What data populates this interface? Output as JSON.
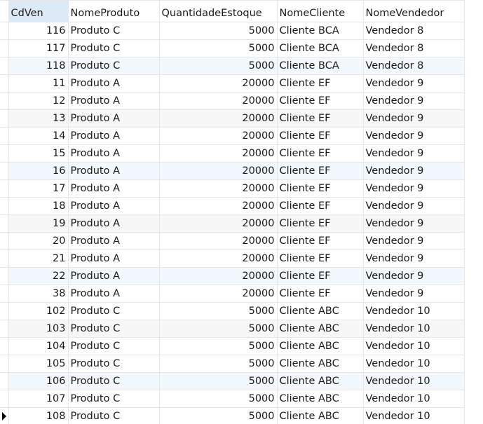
{
  "grid": {
    "columns": [
      "CdVen",
      "NomeProduto",
      "QuantidadeEstoque",
      "NomeCliente",
      "NomeVendedor"
    ],
    "rows": [
      [
        "116",
        "Produto C",
        "5000",
        "Cliente BCA",
        "Vendedor 8"
      ],
      [
        "117",
        "Produto C",
        "5000",
        "Cliente BCA",
        "Vendedor 8"
      ],
      [
        "118",
        "Produto C",
        "5000",
        "Cliente BCA",
        "Vendedor 8"
      ],
      [
        "11",
        "Produto A",
        "20000",
        "Cliente EF",
        "Vendedor 9"
      ],
      [
        "12",
        "Produto A",
        "20000",
        "Cliente EF",
        "Vendedor 9"
      ],
      [
        "13",
        "Produto A",
        "20000",
        "Cliente EF",
        "Vendedor 9"
      ],
      [
        "14",
        "Produto A",
        "20000",
        "Cliente EF",
        "Vendedor 9"
      ],
      [
        "15",
        "Produto A",
        "20000",
        "Cliente EF",
        "Vendedor 9"
      ],
      [
        "16",
        "Produto A",
        "20000",
        "Cliente EF",
        "Vendedor 9"
      ],
      [
        "17",
        "Produto A",
        "20000",
        "Cliente EF",
        "Vendedor 9"
      ],
      [
        "18",
        "Produto A",
        "20000",
        "Cliente EF",
        "Vendedor 9"
      ],
      [
        "19",
        "Produto A",
        "20000",
        "Cliente EF",
        "Vendedor 9"
      ],
      [
        "20",
        "Produto A",
        "20000",
        "Cliente EF",
        "Vendedor 9"
      ],
      [
        "21",
        "Produto A",
        "20000",
        "Cliente EF",
        "Vendedor 9"
      ],
      [
        "22",
        "Produto A",
        "20000",
        "Cliente EF",
        "Vendedor 9"
      ],
      [
        "38",
        "Produto A",
        "20000",
        "Cliente EF",
        "Vendedor 9"
      ],
      [
        "102",
        "Produto C",
        "5000",
        "Cliente ABC",
        "Vendedor 10"
      ],
      [
        "103",
        "Produto C",
        "5000",
        "Cliente ABC",
        "Vendedor 10"
      ],
      [
        "104",
        "Produto C",
        "5000",
        "Cliente ABC",
        "Vendedor 10"
      ],
      [
        "105",
        "Produto C",
        "5000",
        "Cliente ABC",
        "Vendedor 10"
      ],
      [
        "106",
        "Produto C",
        "5000",
        "Cliente ABC",
        "Vendedor 10"
      ],
      [
        "107",
        "Produto C",
        "5000",
        "Cliente ABC",
        "Vendedor 10"
      ],
      [
        "108",
        "Produto C",
        "5000",
        "Cliente ABC",
        "Vendedor 10"
      ]
    ]
  }
}
